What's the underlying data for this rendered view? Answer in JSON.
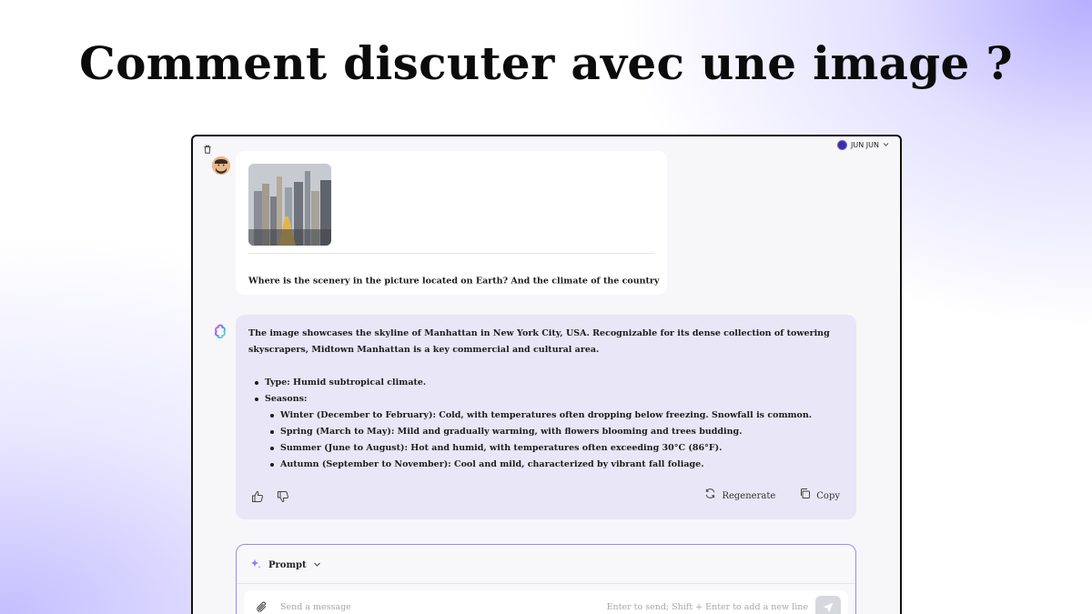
{
  "headline": "Comment discuter avec une image ?",
  "user_menu": {
    "name": "JUN JUN"
  },
  "user_message": {
    "text": "Where is the scenery in the picture located on Earth? And the climate of the country"
  },
  "ai_message": {
    "intro": "The image showcases the skyline of Manhattan in New York City, USA. Recognizable for its dense collection of towering skyscrapers, Midtown Manhattan is a key commercial and cultural area.",
    "type_item": "Type: Humid subtropical climate.",
    "seasons_label": "Seasons:",
    "seasons": [
      "Winter (December to February): Cold, with temperatures often dropping below freezing. Snowfall is common.",
      "Spring (March to May): Mild and gradually warming, with flowers blooming and trees budding.",
      "Summer (June to August): Hot and humid, with temperatures often exceeding 30°C (86°F).",
      "Autumn (September to November): Cool and mild, characterized by vibrant fall foliage."
    ],
    "regenerate_label": "Regenerate",
    "copy_label": "Copy"
  },
  "prompt": {
    "label": "Prompt",
    "placeholder": "Send a message",
    "hint": "Enter to send; Shift + Enter to add a new line"
  },
  "colors": {
    "accent": "#9c8cf0",
    "ai_bubble": "#e9e6f7",
    "user_dot": "#3a2fa8"
  }
}
